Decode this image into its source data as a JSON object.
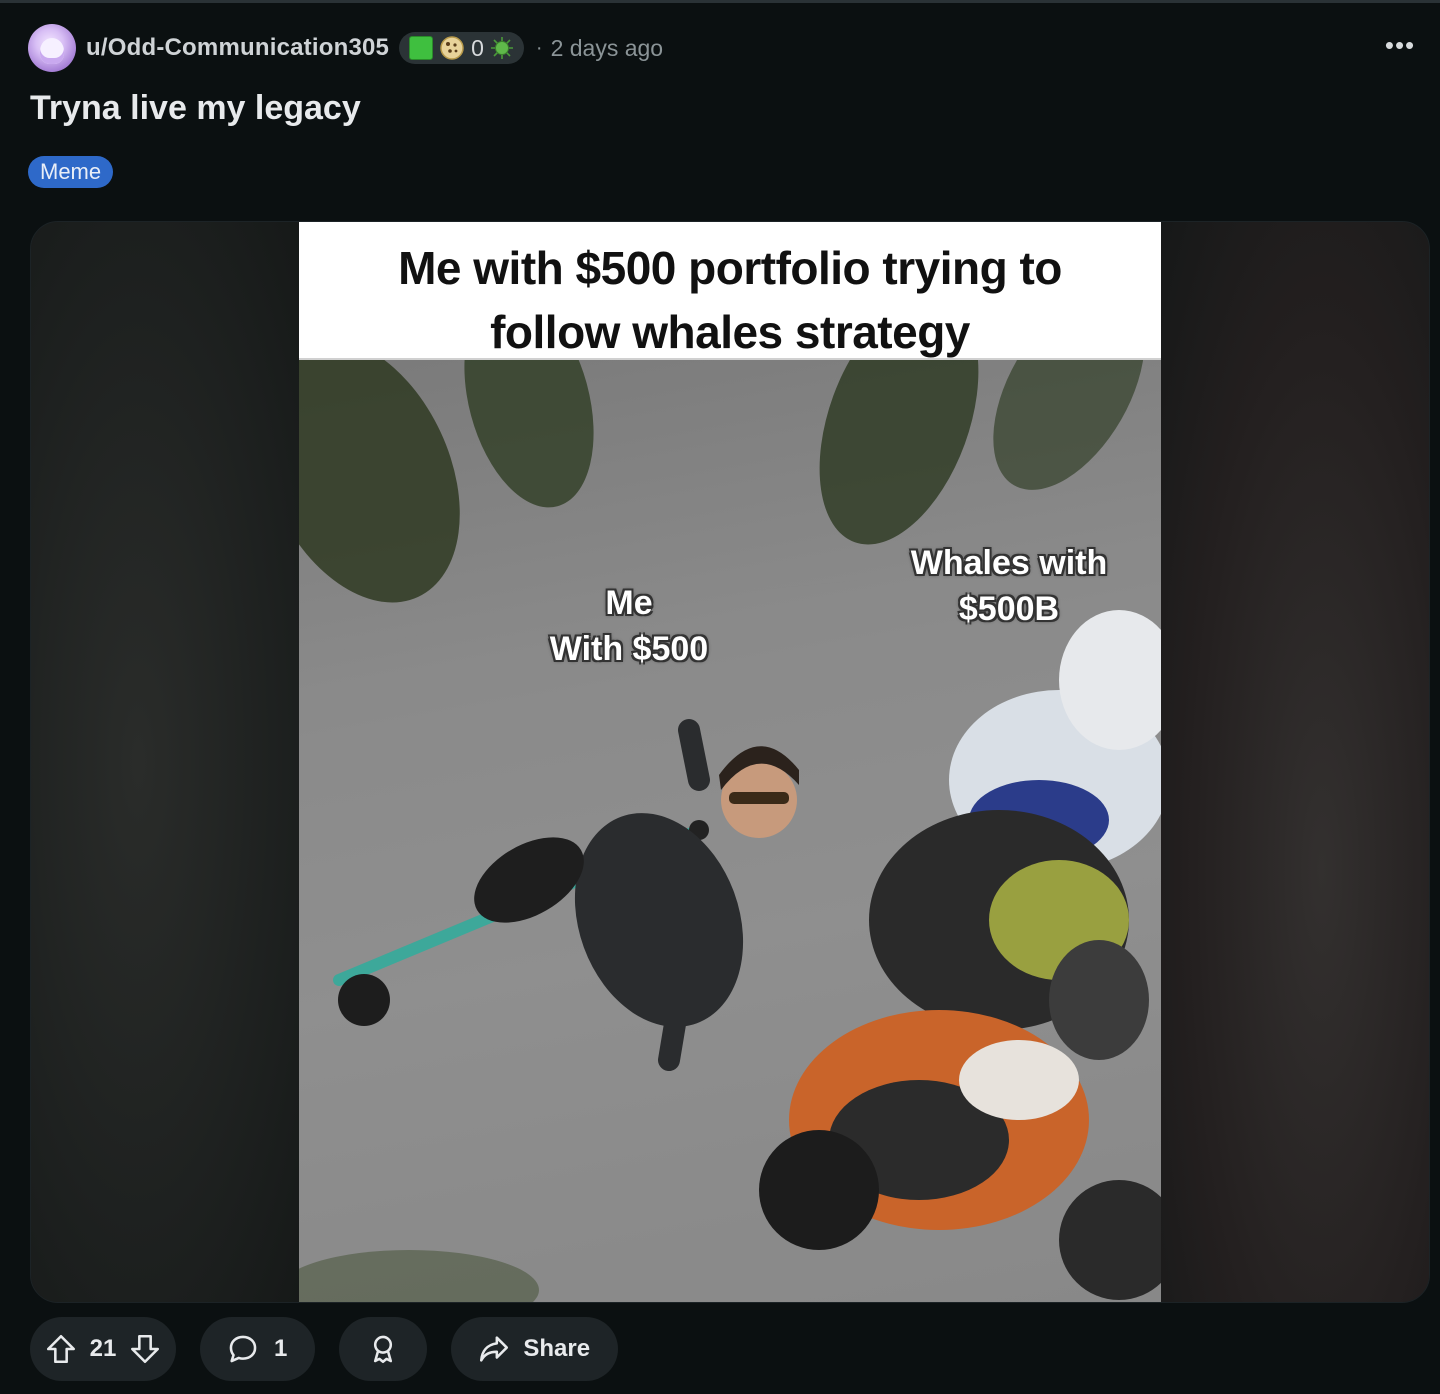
{
  "author": {
    "username": "u/Odd-Communication305",
    "flair_count": "0",
    "timestamp": "2 days ago",
    "separator": "·"
  },
  "post": {
    "title": "Tryna live my legacy",
    "flair": "Meme",
    "more_label": "•••"
  },
  "meme": {
    "caption": "Me with $500 portfolio trying to follow whales strategy",
    "label_me_line1": "Me",
    "label_me_line2": "With $500",
    "label_whales_line1": "Whales with",
    "label_whales_line2": "$500B"
  },
  "actions": {
    "score": "21",
    "comments": "1",
    "share_label": "Share"
  },
  "colors": {
    "background": "#0b1011",
    "flair_bg": "#2e69c9",
    "pill_bg": "#1e2427"
  },
  "icons": [
    "avatar",
    "green-square-icon",
    "cookie-icon",
    "virus-icon",
    "more-icon",
    "upvote-icon",
    "downvote-icon",
    "comment-icon",
    "award-icon",
    "share-icon"
  ]
}
